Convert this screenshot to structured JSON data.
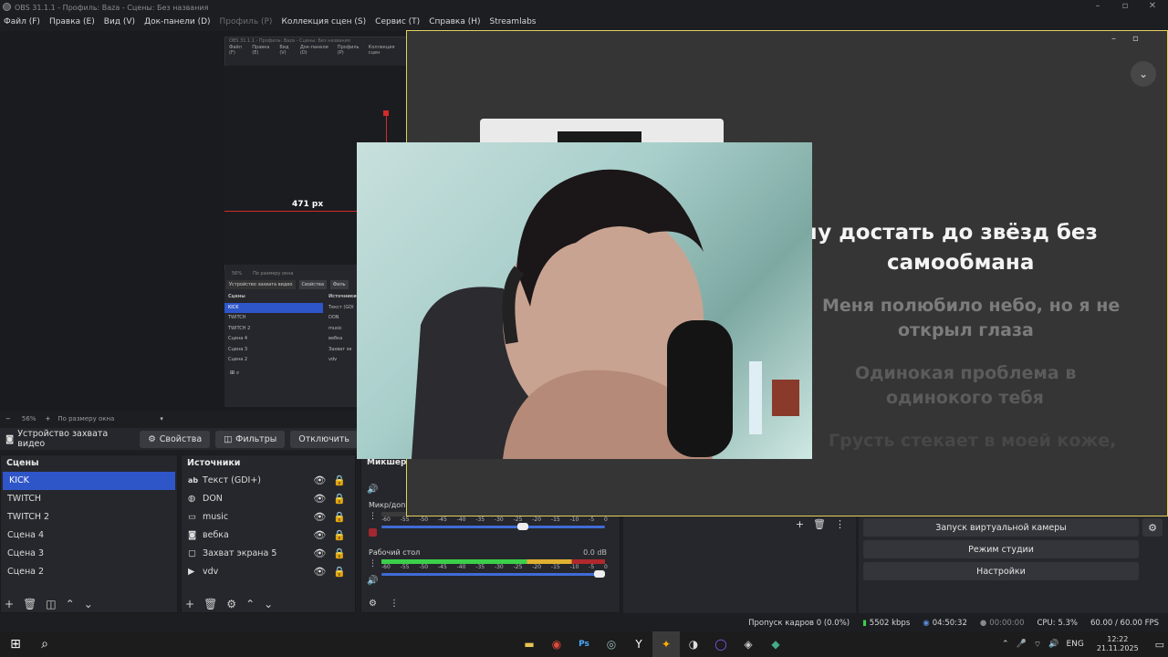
{
  "window": {
    "title": "OBS 31.1.1 - Профиль: Baza - Сцены: Без названия"
  },
  "menu": [
    "Файл (F)",
    "Правка (E)",
    "Вид (V)",
    "Док-панели (D)",
    "Профиль (P)",
    "Коллекция сцен (S)",
    "Сервис (T)",
    "Справка (H)",
    "Streamlabs"
  ],
  "mini_obs": {
    "title": "OBS 31.1.1 - Профиль: Baza - Сцены: Без названия",
    "menu": [
      "Файл (F)",
      "Правка (E)",
      "Вид (V)",
      "Док-панели (D)",
      "Профиль (P)",
      "Коллекция сцен"
    ],
    "px_label": "471 px",
    "zoom": "56%",
    "zoom_mode": "По размеру окна",
    "source_btn": "Устройство захвата видео",
    "props_btn": "Свойства",
    "filters_btn": "Филь",
    "scenes_title": "Сцены",
    "sources_title": "Источники",
    "scenes": [
      "KICK",
      "TWITCH",
      "TWITCH 2",
      "Сцена 4",
      "Сцена 3",
      "Сцена 2"
    ],
    "sources": [
      "Текст (GDI",
      "DON",
      "music",
      "вебка",
      "Захват эк",
      "vdv"
    ]
  },
  "zoombar": {
    "zoom": "56%",
    "mode": "По размеру окна"
  },
  "source_toolbar": {
    "source_name": "Устройство захвата видео",
    "properties": "Свойства",
    "filters": "Фильтры",
    "disable": "Отключить"
  },
  "scenes": {
    "title": "Сцены",
    "items": [
      "KICK",
      "TWITCH",
      "TWITCH 2",
      "Сцена 4",
      "Сцена 3",
      "Сцена 2"
    ],
    "selected": "KICK"
  },
  "sources": {
    "title": "Источники",
    "items": [
      {
        "name": "Текст (GDI+)",
        "icon": "text-icon"
      },
      {
        "name": "DON",
        "icon": "browser-icon"
      },
      {
        "name": "music",
        "icon": "folder-icon"
      },
      {
        "name": "вебка",
        "icon": "camera-icon"
      },
      {
        "name": "Захват экрана 5",
        "icon": "monitor-icon"
      },
      {
        "name": "vdv",
        "icon": "play-icon"
      }
    ]
  },
  "mixer": {
    "title": "Микшер з",
    "channels": [
      {
        "name": "Микр/доп",
        "db": "",
        "level": 0.0,
        "volume": 0.64
      },
      {
        "name": "Рабочий стол",
        "db": "0.0 dB",
        "level": 0.85,
        "volume": 1.0
      }
    ],
    "scale": [
      "-60",
      "-55",
      "-50",
      "-45",
      "-40",
      "-35",
      "-30",
      "-25",
      "-20",
      "-15",
      "-10",
      "-5",
      "0"
    ]
  },
  "controls": {
    "virtual_cam": "Запуск виртуальной камеры",
    "studio_mode": "Режим студии",
    "settings": "Настройки"
  },
  "status": {
    "dropped": "Пропуск кадров 0 (0.0%)",
    "bitrate": "5502 kbps",
    "live_time": "04:50:32",
    "rec_time": "00:00:00",
    "cpu": "CPU: 5.3%",
    "fps": "60.00 / 60.00 FPS"
  },
  "overlay": {
    "line1a": "о хочу достать до звёзд без",
    "line1b": "самообмана",
    "line2a": "Меня полюбило небо, но я не",
    "line2b": "открыл глаза",
    "line3a": "Одинокая проблема в",
    "line3b": "одинокого тебя",
    "line4a": "Грусть стекает в моей коже,"
  },
  "taskbar": {
    "lang": "ENG",
    "time": "12:22",
    "date": "21.11.2025"
  },
  "colors": {
    "selection": "#2f56c8",
    "overlay_border": "#e3d15a",
    "meter_green": "#3ccf4a",
    "meter_yellow": "#e0b030",
    "meter_red": "#b0282d"
  }
}
